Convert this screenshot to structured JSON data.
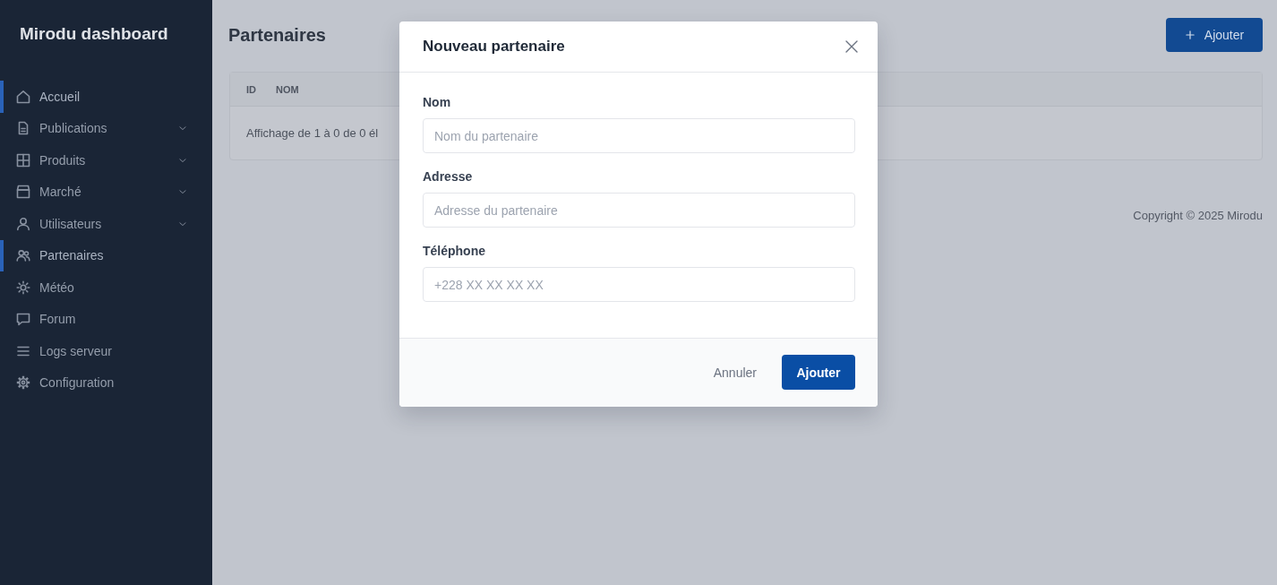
{
  "sidebar": {
    "brand": "Mirodu dashboard",
    "items": [
      {
        "label": "Accueil",
        "selected": true,
        "expandable": false
      },
      {
        "label": "Publications",
        "selected": false,
        "expandable": true
      },
      {
        "label": "Produits",
        "selected": false,
        "expandable": true
      },
      {
        "label": "Marché",
        "selected": false,
        "expandable": true
      },
      {
        "label": "Utilisateurs",
        "selected": false,
        "expandable": true
      },
      {
        "label": "Partenaires",
        "selected": true,
        "expandable": false
      },
      {
        "label": "Météo",
        "selected": false,
        "expandable": false
      },
      {
        "label": "Forum",
        "selected": false,
        "expandable": false
      },
      {
        "label": "Logs serveur",
        "selected": false,
        "expandable": false
      },
      {
        "label": "Configuration",
        "selected": false,
        "expandable": false
      }
    ]
  },
  "page": {
    "title": "Partenaires",
    "add_button": "Ajouter",
    "table": {
      "columns": [
        "ID",
        "NOM"
      ],
      "info": "Affichage de 1 à 0 de 0 él"
    },
    "footer": "Copyright © 2025 Mirodu"
  },
  "modal": {
    "title": "Nouveau partenaire",
    "fields": [
      {
        "label": "Nom",
        "placeholder": "Nom du partenaire"
      },
      {
        "label": "Adresse",
        "placeholder": "Adresse du partenaire"
      },
      {
        "label": "Téléphone",
        "placeholder": "+228 XX XX XX XX"
      }
    ],
    "buttons": [
      {
        "label": "Annuler",
        "kind": "secondary"
      },
      {
        "label": "Ajouter",
        "kind": "primary"
      }
    ]
  }
}
